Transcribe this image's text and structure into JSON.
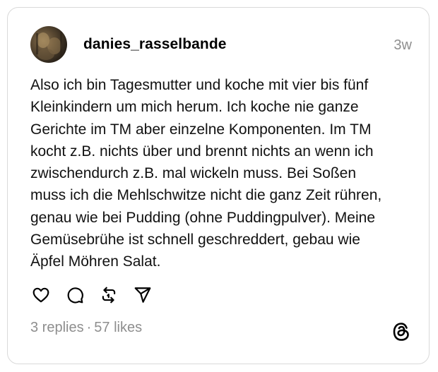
{
  "post": {
    "username": "danies_rasselbande",
    "timestamp": "3w",
    "text": "Also ich bin Tagesmutter und koche mit vier bis fünf\nKleinkindern um mich herum. Ich koche nie ganze\nGerichte im TM aber einzelne Komponenten. Im TM\nkocht z.B. nichts über und brennt nichts an wenn ich\nzwischendurch z.B. mal wickeln muss. Bei Soßen\nmuss ich die Mehlschwitze nicht die ganz Zeit rühren,\ngenau wie bei Pudding (ohne Puddingpulver). Meine\nGemüsebrühe ist schnell geschreddert, gebau wie\nÄpfel Möhren Salat.",
    "replies": "3 replies",
    "separator": "·",
    "likes": "57 likes"
  },
  "actions": [
    {
      "name": "like",
      "icon": "heart-icon"
    },
    {
      "name": "reply",
      "icon": "speech-bubble-icon"
    },
    {
      "name": "repost",
      "icon": "repost-icon"
    },
    {
      "name": "share",
      "icon": "send-icon"
    }
  ],
  "brand": {
    "icon": "threads-logo-icon"
  },
  "colors": {
    "text": "#111111",
    "muted": "#8e8e8e",
    "border": "#d9d9d9",
    "background": "#ffffff"
  }
}
